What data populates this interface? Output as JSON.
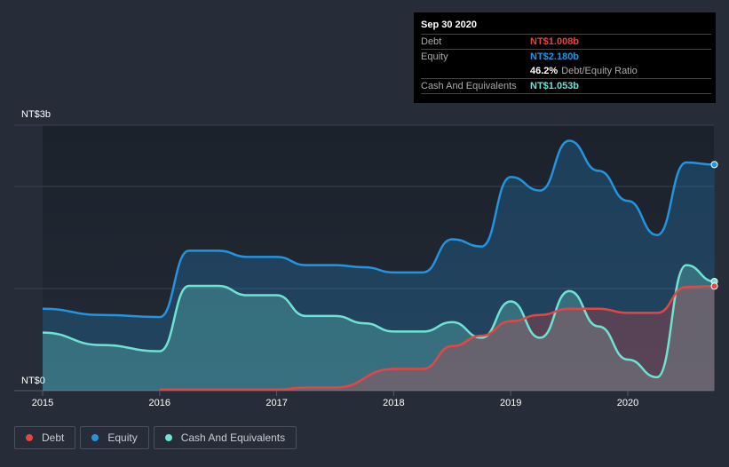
{
  "tooltip": {
    "date": "Sep 30 2020",
    "debt_label": "Debt",
    "debt_value": "NT$1.008b",
    "equity_label": "Equity",
    "equity_value": "NT$2.180b",
    "ratio_value": "46.2%",
    "ratio_label": "Debt/Equity Ratio",
    "cash_label": "Cash And Equivalents",
    "cash_value": "NT$1.053b"
  },
  "legend": [
    {
      "label": "Debt"
    },
    {
      "label": "Equity"
    },
    {
      "label": "Cash And Equivalents"
    }
  ],
  "colors": {
    "debt": "#e64545",
    "equity": "#2394df",
    "cash": "#6fe2d3"
  },
  "chart_data": {
    "type": "area",
    "y_top_label": "NT$3b",
    "y_bottom_label": "NT$0",
    "x_ticks": [
      "2015",
      "2016",
      "2017",
      "2018",
      "2019",
      "2020"
    ],
    "xlim": [
      2014.9,
      2020.74
    ],
    "ylim": [
      0,
      2.56
    ],
    "series": [
      {
        "name": "Equity",
        "points": [
          [
            2015,
            0.79
          ],
          [
            2015.5,
            0.73
          ],
          [
            2016,
            0.71
          ],
          [
            2016.25,
            1.35
          ],
          [
            2016.5,
            1.35
          ],
          [
            2016.75,
            1.29
          ],
          [
            2017,
            1.29
          ],
          [
            2017.25,
            1.21
          ],
          [
            2017.5,
            1.21
          ],
          [
            2017.75,
            1.19
          ],
          [
            2018,
            1.14
          ],
          [
            2018.25,
            1.14
          ],
          [
            2018.5,
            1.46
          ],
          [
            2018.75,
            1.39
          ],
          [
            2019,
            2.06
          ],
          [
            2019.25,
            1.93
          ],
          [
            2019.5,
            2.41
          ],
          [
            2019.75,
            2.12
          ],
          [
            2020,
            1.83
          ],
          [
            2020.25,
            1.5
          ],
          [
            2020.5,
            2.2
          ],
          [
            2020.74,
            2.18
          ]
        ]
      },
      {
        "name": "Cash And Equivalents",
        "points": [
          [
            2015,
            0.56
          ],
          [
            2015.5,
            0.44
          ],
          [
            2016,
            0.38
          ],
          [
            2016.25,
            1.01
          ],
          [
            2016.5,
            1.01
          ],
          [
            2016.75,
            0.92
          ],
          [
            2017,
            0.92
          ],
          [
            2017.25,
            0.72
          ],
          [
            2017.5,
            0.72
          ],
          [
            2017.75,
            0.65
          ],
          [
            2018,
            0.57
          ],
          [
            2018.25,
            0.57
          ],
          [
            2018.5,
            0.66
          ],
          [
            2018.75,
            0.51
          ],
          [
            2019,
            0.86
          ],
          [
            2019.25,
            0.51
          ],
          [
            2019.5,
            0.96
          ],
          [
            2019.75,
            0.62
          ],
          [
            2020,
            0.3
          ],
          [
            2020.25,
            0.13
          ],
          [
            2020.5,
            1.21
          ],
          [
            2020.74,
            1.053
          ]
        ]
      },
      {
        "name": "Debt",
        "points": [
          [
            2016,
            0.01
          ],
          [
            2017,
            0.01
          ],
          [
            2017.25,
            0.03
          ],
          [
            2017.5,
            0.03
          ],
          [
            2018,
            0.21
          ],
          [
            2018.25,
            0.21
          ],
          [
            2018.5,
            0.43
          ],
          [
            2018.75,
            0.53
          ],
          [
            2019,
            0.67
          ],
          [
            2019.25,
            0.73
          ],
          [
            2019.5,
            0.79
          ],
          [
            2019.75,
            0.79
          ],
          [
            2020,
            0.75
          ],
          [
            2020.25,
            0.75
          ],
          [
            2020.5,
            1.0
          ],
          [
            2020.74,
            1.008
          ]
        ]
      }
    ]
  }
}
